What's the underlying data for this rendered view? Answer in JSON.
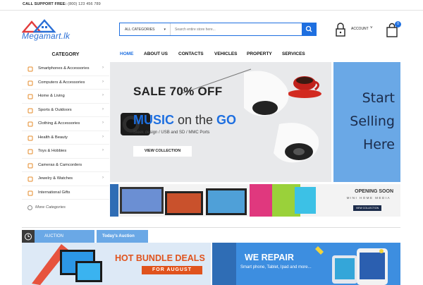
{
  "topbar": {
    "support_label": "CALL SUPPORT FREE:",
    "support_phone": " (800) 123 456 789"
  },
  "header": {
    "logo_text": "Megamart.lk",
    "search": {
      "category": "ALL CATEGORIES",
      "placeholder": "Search entire store here..."
    },
    "account_label": "ACCOUNT",
    "cart_count": "0"
  },
  "sidebar": {
    "title": "CATEGORY",
    "items": [
      {
        "label": "Smartphones & Accessories",
        "has_sub": true,
        "icon": "smartphone-icon"
      },
      {
        "label": "Computers & Accessories",
        "has_sub": true,
        "icon": "computer-icon"
      },
      {
        "label": "Home & Living",
        "has_sub": true,
        "icon": "home-icon"
      },
      {
        "label": "Sports & Outdoors",
        "has_sub": true,
        "icon": "sports-icon"
      },
      {
        "label": "Clothing & Accessories",
        "has_sub": true,
        "icon": "clothing-icon"
      },
      {
        "label": "Health & Beauty",
        "has_sub": true,
        "icon": "health-icon"
      },
      {
        "label": "Toys & Hobbies",
        "has_sub": true,
        "icon": "toys-icon"
      },
      {
        "label": "Cameras & Camcorders",
        "has_sub": false,
        "icon": "camera-icon"
      },
      {
        "label": "Jewelry & Watches",
        "has_sub": true,
        "icon": "jewelry-icon"
      },
      {
        "label": "International Gifts",
        "has_sub": false,
        "icon": "gift-icon"
      }
    ],
    "more_label": "More Categories"
  },
  "nav": {
    "items": [
      "HOME",
      "ABOUT US",
      "CONTACTS",
      "VEHICLES",
      "PROPERTY",
      "SERVICES"
    ],
    "active": "HOME"
  },
  "hero": {
    "sale": "SALE 70% OFF",
    "music_a": "MUSIC",
    "music_b": " on the ",
    "music_c": "GO",
    "subtitle": "Sleek design / USB and SD / MMC Ports",
    "button": "VIEW COLLECTION"
  },
  "side_banner": {
    "lines": [
      "Start",
      "Selling",
      "Here"
    ]
  },
  "band2": {
    "title": "OPENING SOON",
    "subtitle": "MINI HOME MEDIA",
    "button": "VIEW COLLECTION"
  },
  "auction": {
    "tab1": "AUCTION",
    "tab2": "Today's Auction"
  },
  "deals": {
    "title": "HOT BUNDLE DEALS",
    "badge": "FOR AUGUST"
  },
  "repair": {
    "title": "WE REPAIR",
    "subtitle": "Smart phone, Tablet, Ipad and more..."
  },
  "colors": {
    "accent": "#1e6fe0",
    "sky": "#6aa8e6",
    "orange": "#e0531d"
  }
}
